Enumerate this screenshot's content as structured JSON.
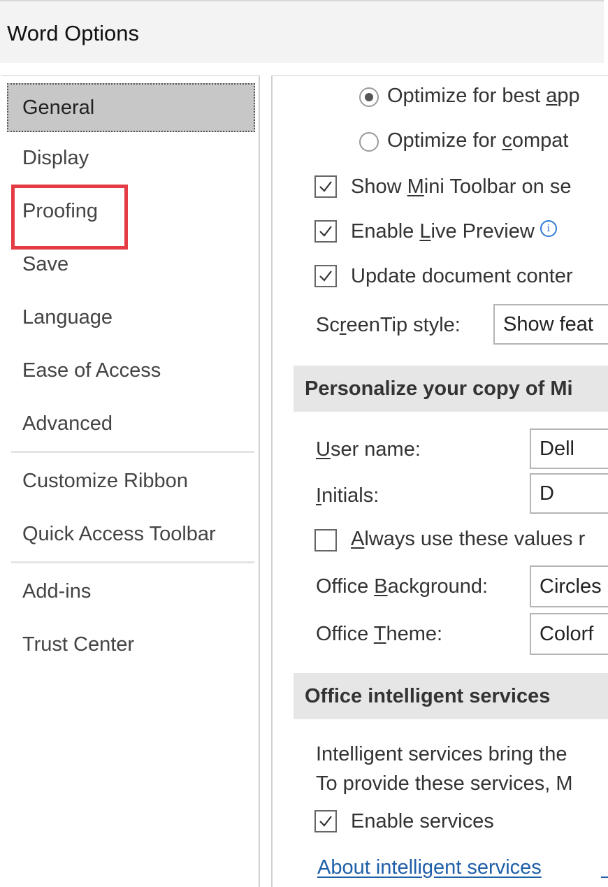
{
  "window": {
    "title": "Word Options"
  },
  "nav": {
    "items": [
      {
        "label": "General"
      },
      {
        "label": "Display"
      },
      {
        "label": "Proofing"
      },
      {
        "label": "Save"
      },
      {
        "label": "Language"
      },
      {
        "label": "Ease of Access"
      },
      {
        "label": "Advanced"
      },
      {
        "label": "Customize Ribbon"
      },
      {
        "label": "Quick Access Toolbar"
      },
      {
        "label": "Add-ins"
      },
      {
        "label": "Trust Center"
      }
    ],
    "selected": "General",
    "highlighted": "Proofing",
    "highlight_color": "#e43b45"
  },
  "general": {
    "optimize_best": {
      "pre": "Optimize for best ",
      "u": "a",
      "post": "pp",
      "selected": true
    },
    "optimize_compat": {
      "pre": "Optimize for ",
      "u": "c",
      "post": "ompat",
      "selected": false
    },
    "mini_toolbar": {
      "pre": "Show ",
      "u": "M",
      "post": "ini Toolbar on se",
      "checked": true
    },
    "live_preview": {
      "pre": "Enable ",
      "u": "L",
      "post": "ive Preview",
      "checked": true
    },
    "update_content": {
      "label": "Update document conter",
      "checked": true
    },
    "screentip": {
      "pre": "Sc",
      "u": "r",
      "post": "eenTip style:",
      "value": "Show feat"
    }
  },
  "personalize": {
    "header": "Personalize your copy of Mi",
    "user_name": {
      "u": "U",
      "post": "ser name:",
      "value": "Dell"
    },
    "initials": {
      "u": "I",
      "post": "nitials:",
      "value": "D"
    },
    "always_use": {
      "u": "A",
      "post": "lways use these values r",
      "checked": false
    },
    "background": {
      "pre": "Office ",
      "u": "B",
      "post": "ackground:",
      "value": "Circles"
    },
    "theme": {
      "pre": "Office ",
      "u": "T",
      "post": "heme:",
      "value": "Colorf"
    }
  },
  "intelligent": {
    "header": "Office intelligent services",
    "line1": "Intelligent services bring the",
    "line2": "To provide these services, M",
    "enable": {
      "label": "Enable services",
      "checked": true
    },
    "about_link": "About intelligent services",
    "link_color": "#1f5fa8"
  }
}
